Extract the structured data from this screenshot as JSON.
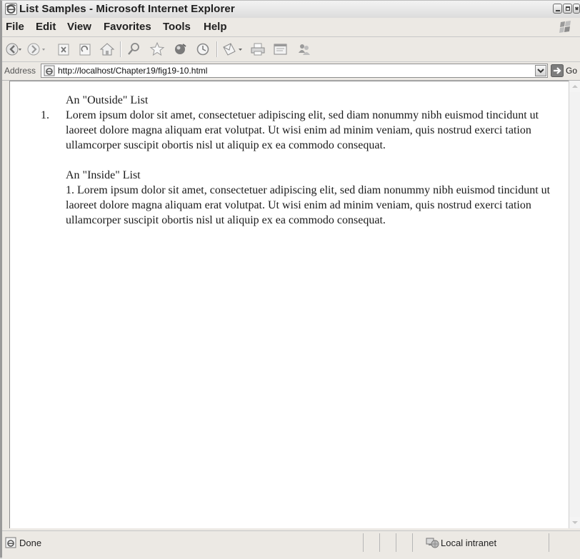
{
  "window": {
    "title": "List Samples - Microsoft Internet Explorer"
  },
  "menu": {
    "items": [
      "File",
      "Edit",
      "View",
      "Favorites",
      "Tools",
      "Help"
    ]
  },
  "toolbar": {
    "buttons": [
      "back-icon",
      "forward-icon",
      "stop-icon",
      "refresh-icon",
      "home-icon",
      "search-icon",
      "favorites-icon",
      "media-icon",
      "history-icon",
      "mail-icon",
      "print-icon",
      "edit-icon",
      "messenger-icon"
    ]
  },
  "address": {
    "label": "Address",
    "url": "http://localhost/Chapter19/fig19-10.html",
    "go_label": "Go"
  },
  "content": {
    "outside_heading": "An \"Outside\" List",
    "outside_marker": "1.",
    "outside_text": "Lorem ipsum dolor sit amet, consectetuer adipiscing elit, sed diam nonummy nibh euismod tincidunt ut laoreet dolore magna aliquam erat volutpat. Ut wisi enim ad minim veniam, quis nostrud exerci tation ullamcorper suscipit obortis nisl ut aliquip ex ea commodo consequat.",
    "inside_heading": "An \"Inside\" List",
    "inside_text": "1. Lorem ipsum dolor sit amet, consectetuer adipiscing elit, sed diam nonummy nibh euismod tincidunt ut laoreet dolore magna aliquam erat volutpat. Ut wisi enim ad minim veniam, quis nostrud exerci tation ullamcorper suscipit obortis nisl ut aliquip ex ea commodo consequat."
  },
  "status": {
    "text": "Done",
    "zone": "Local intranet"
  }
}
